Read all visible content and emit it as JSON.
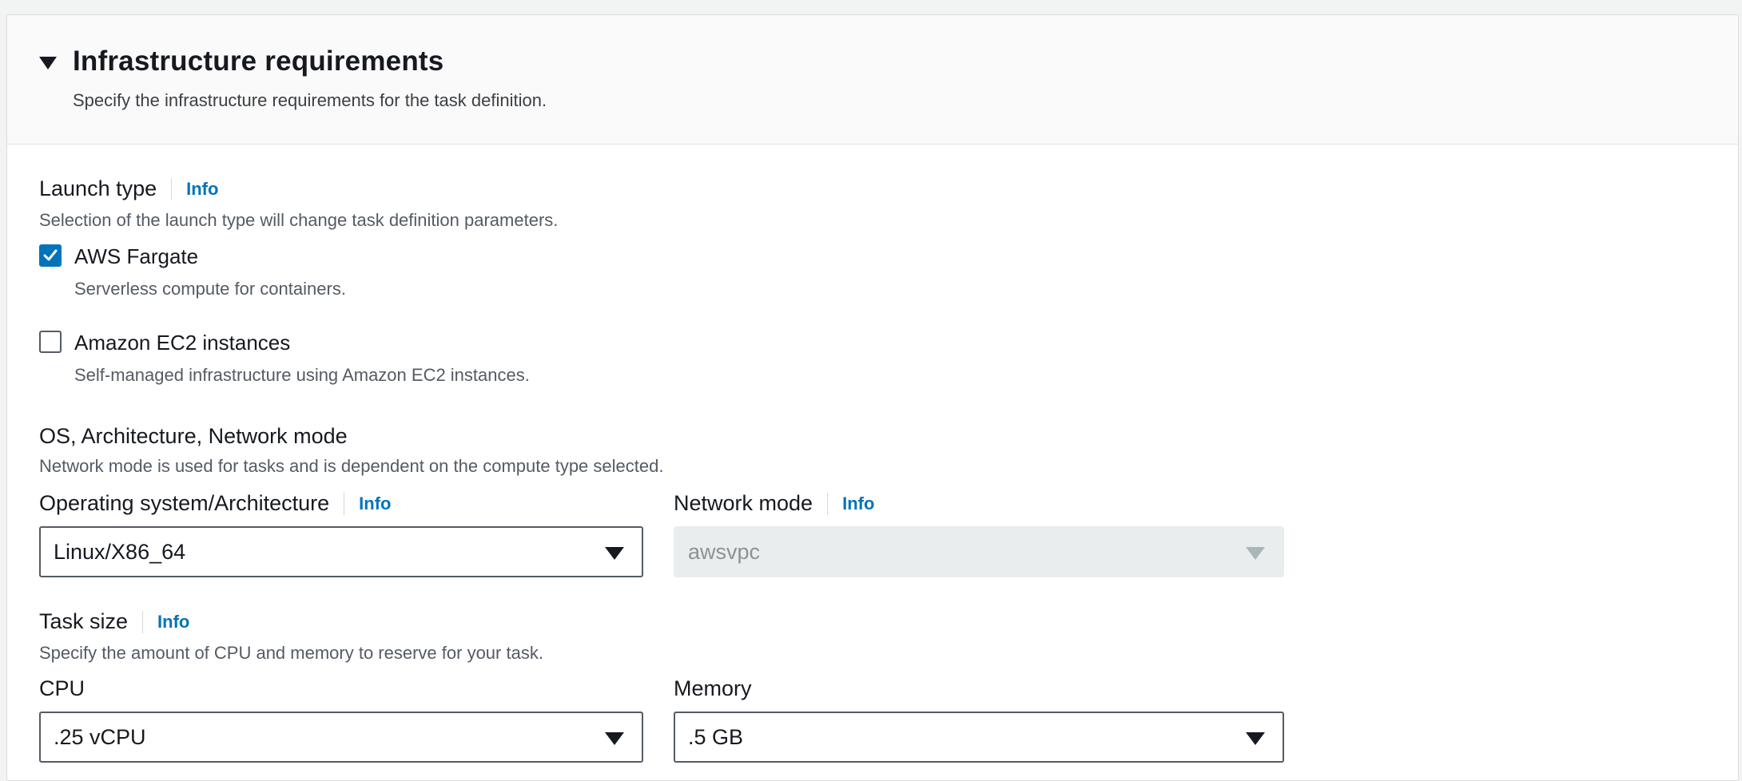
{
  "section": {
    "title": "Infrastructure requirements",
    "description": "Specify the infrastructure requirements for the task definition."
  },
  "launch_type": {
    "label": "Launch type",
    "info": "Info",
    "description": "Selection of the launch type will change task definition parameters.",
    "options": [
      {
        "label": "AWS Fargate",
        "description": "Serverless compute for containers.",
        "checked": true
      },
      {
        "label": "Amazon EC2 instances",
        "description": "Self-managed infrastructure using Amazon EC2 instances.",
        "checked": false
      }
    ]
  },
  "os_arch_network": {
    "label": "OS, Architecture, Network mode",
    "description": "Network mode is used for tasks and is dependent on the compute type selected.",
    "os_arch": {
      "label": "Operating system/Architecture",
      "info": "Info",
      "value": "Linux/X86_64"
    },
    "network_mode": {
      "label": "Network mode",
      "info": "Info",
      "value": "awsvpc",
      "disabled": true
    }
  },
  "task_size": {
    "label": "Task size",
    "info": "Info",
    "description": "Specify the amount of CPU and memory to reserve for your task.",
    "cpu": {
      "label": "CPU",
      "value": ".25 vCPU"
    },
    "memory": {
      "label": "Memory",
      "value": ".5 GB"
    }
  },
  "colors": {
    "accent": "#0073bb",
    "header_bg": "#fafafa",
    "disabled_bg": "#eaeded"
  },
  "icons": {
    "collapse": "caret-down-icon",
    "check": "checkmark-icon",
    "dropdown": "caret-down-icon"
  }
}
